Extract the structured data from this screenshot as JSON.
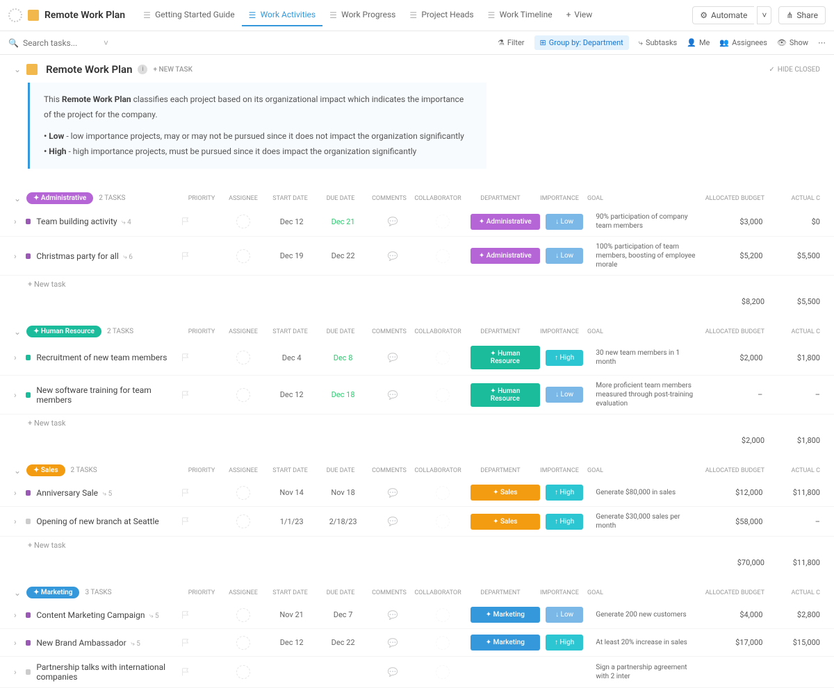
{
  "workspace": {
    "title": "Remote Work Plan"
  },
  "tabs": [
    {
      "label": "Getting Started Guide"
    },
    {
      "label": "Work Activities",
      "active": true
    },
    {
      "label": "Work Progress"
    },
    {
      "label": "Project Heads"
    },
    {
      "label": "Work Timeline"
    },
    {
      "label": "View",
      "add": true
    }
  ],
  "topRight": {
    "automate": "Automate",
    "share": "Share"
  },
  "search": {
    "placeholder": "Search tasks..."
  },
  "toolbar": {
    "filter": "Filter",
    "groupby": "Group by: Department",
    "subtasks": "Subtasks",
    "me": "Me",
    "assignees": "Assignees",
    "show": "Show"
  },
  "header": {
    "title": "Remote Work Plan",
    "newtask": "+ NEW TASK",
    "hideClosed": "HIDE CLOSED"
  },
  "desc": {
    "line1a": "This ",
    "line1b": "Remote Work Plan",
    "line1c": " classifies each project based on its organizational impact which indicates the importance of the project for the company.",
    "low": "• Low",
    "lowT": " - low importance projects, may or may not be pursued since it does not impact the organization significantly",
    "high": "• High",
    "highT": " - high importance projects, must be pursued since it does impact the organization significantly"
  },
  "cols": {
    "priority": "PRIORITY",
    "assignee": "ASSIGNEE",
    "start": "START DATE",
    "due": "DUE DATE",
    "comments": "COMMENTS",
    "collab": "COLLABORATOR",
    "dept": "DEPARTMENT",
    "imp": "IMPORTANCE",
    "goal": "GOAL",
    "budget": "ALLOCATED BUDGET",
    "actual": "ACTUAL C"
  },
  "groups": [
    {
      "id": "admin",
      "pill": "Administrative",
      "pillClass": "admin",
      "count": "2 TASKS",
      "tasks": [
        {
          "chk": "pu",
          "name": "Team building activity",
          "sub": "4",
          "start": "Dec 12",
          "due": "Dec 21",
          "dueG": true,
          "dept": "Administrative",
          "deptC": "admin",
          "imp": "Low",
          "impC": "low",
          "goal": "90% participation of company team members",
          "budget": "$3,000",
          "actual": "$0"
        },
        {
          "chk": "pu",
          "name": "Christmas party for all",
          "sub": "6",
          "start": "Dec 19",
          "due": "Dec 22",
          "dept": "Administrative",
          "deptC": "admin",
          "imp": "Low",
          "impC": "low",
          "goal": "100% participation of team members, boosting of employee morale",
          "budget": "$5,200",
          "actual": "$5,500"
        }
      ],
      "totalB": "$8,200",
      "totalA": "$5,500"
    },
    {
      "id": "hr",
      "pill": "Human Resource",
      "pillClass": "hr",
      "count": "2 TASKS",
      "tasks": [
        {
          "chk": "gn",
          "name": "Recruitment of new team members",
          "start": "Dec 4",
          "due": "Dec 8",
          "dueG": true,
          "dept": "Human Resource",
          "deptC": "hr",
          "imp": "High",
          "impC": "high",
          "goal": "30 new team members in 1 month",
          "budget": "$2,000",
          "actual": "$1,800"
        },
        {
          "chk": "gn",
          "name": "New software training for team members",
          "start": "Dec 12",
          "due": "Dec 18",
          "dueG": true,
          "dept": "Human Resource",
          "deptC": "hr",
          "imp": "Low",
          "impC": "low",
          "goal": "More proficient team members measured through post-training evaluation",
          "budget": "–",
          "actual": "–"
        }
      ],
      "totalB": "$2,000",
      "totalA": "$1,800"
    },
    {
      "id": "sales",
      "pill": "Sales",
      "pillClass": "sales",
      "count": "2 TASKS",
      "tasks": [
        {
          "chk": "pu",
          "name": "Anniversary Sale",
          "sub": "5",
          "start": "Nov 14",
          "due": "Nov 18",
          "dept": "Sales",
          "deptC": "sales",
          "imp": "High",
          "impC": "high",
          "goal": "Generate $80,000 in sales",
          "budget": "$12,000",
          "actual": "$11,800"
        },
        {
          "chk": "gy",
          "name": "Opening of new branch at Seattle",
          "start": "1/1/23",
          "due": "2/18/23",
          "dept": "Sales",
          "deptC": "sales",
          "imp": "High",
          "impC": "high",
          "goal": "Generate $30,000 sales per month",
          "budget": "$58,000",
          "actual": "–"
        }
      ],
      "totalB": "$70,000",
      "totalA": "$11,800"
    },
    {
      "id": "mkt",
      "pill": "Marketing",
      "pillClass": "mkt",
      "count": "3 TASKS",
      "tasks": [
        {
          "chk": "pu",
          "name": "Content Marketing Campaign",
          "sub": "5",
          "start": "Nov 21",
          "due": "Dec 7",
          "dept": "Marketing",
          "deptC": "mkt",
          "imp": "Low",
          "impC": "low",
          "goal": "Generate 200 new customers",
          "budget": "$4,000",
          "actual": "$2,800"
        },
        {
          "chk": "pu",
          "name": "New Brand Ambassador",
          "sub": "5",
          "start": "Dec 12",
          "due": "Dec 22",
          "dept": "Marketing",
          "deptC": "mkt",
          "imp": "High",
          "impC": "high",
          "goal": "At least 20% increase in sales",
          "budget": "$17,000",
          "actual": "$15,000"
        },
        {
          "chk": "gy",
          "name": "Partnership talks with international companies",
          "goal": "Sign a partnership agreement with 2 inter"
        }
      ]
    }
  ],
  "newTask": "+ New task"
}
